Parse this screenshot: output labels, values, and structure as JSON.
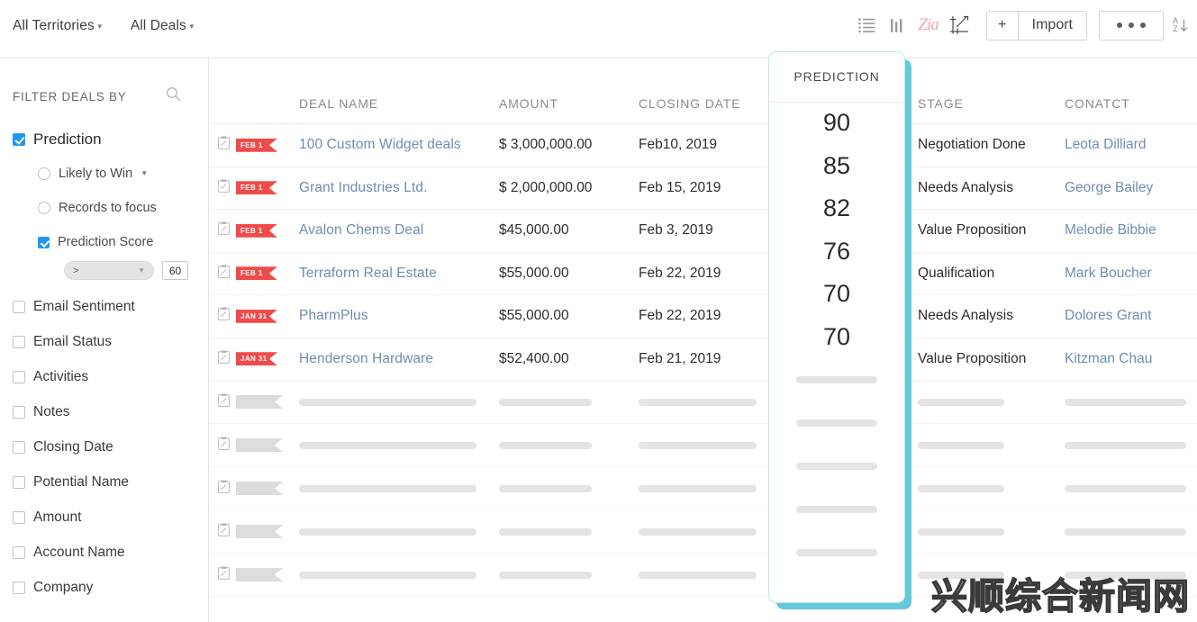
{
  "topbar": {
    "filters": [
      {
        "label": "All Territories",
        "icon": "chevron-down-icon"
      },
      {
        "label": "All Deals",
        "icon": "chevron-down-icon"
      }
    ],
    "icons": [
      {
        "name": "list-view-icon",
        "glyph": "☰"
      },
      {
        "name": "kanban-view-icon",
        "glyph": "|||"
      },
      {
        "name": "zia-logo-icon",
        "glyph": "Zia"
      },
      {
        "name": "chart-edit-icon",
        "glyph": "chart"
      }
    ],
    "add_label": "+",
    "import_label": "Import",
    "more_label": "...",
    "sort_icon": "sort-az-icon",
    "sort_top": "A",
    "sort_bottom": "Z"
  },
  "sidebar": {
    "title": "FILTER DEALS BY",
    "search_icon": "search-icon",
    "prediction": {
      "label": "Prediction",
      "checked": true,
      "options": [
        {
          "label": "Likely to Win",
          "type": "radio",
          "checked": false,
          "caret": true
        },
        {
          "label": "Records to focus",
          "type": "radio",
          "checked": false,
          "caret": false
        },
        {
          "label": "Prediction Score",
          "type": "checkbox",
          "checked": true,
          "caret": false
        }
      ],
      "score_operator": ">",
      "score_value": "60"
    },
    "items": [
      {
        "label": "Email Sentiment",
        "checked": false
      },
      {
        "label": "Email Status",
        "checked": false
      },
      {
        "label": "Activities",
        "checked": false
      },
      {
        "label": "Notes",
        "checked": false
      },
      {
        "label": "Closing Date",
        "checked": false
      },
      {
        "label": "Potential Name",
        "checked": false
      },
      {
        "label": "Amount",
        "checked": false
      },
      {
        "label": "Account Name",
        "checked": false
      },
      {
        "label": "Company",
        "checked": false
      }
    ]
  },
  "table": {
    "columns": [
      {
        "key": "icon",
        "label": ""
      },
      {
        "key": "name",
        "label": "DEAL NAME"
      },
      {
        "key": "amount",
        "label": "AMOUNT"
      },
      {
        "key": "date",
        "label": "CLOSING DATE"
      },
      {
        "key": "pred",
        "label": "PREDICTION"
      },
      {
        "key": "stage",
        "label": "STAGE"
      },
      {
        "key": "contact",
        "label": "CONATCT"
      }
    ],
    "rows": [
      {
        "badge": "FEB 1",
        "name": "100 Custom Widget deals",
        "amount": "$ 3,000,000.00",
        "date": "Feb10, 2019",
        "prediction": "90",
        "stage": "Negotiation Done",
        "contact": "Leota Dilliard"
      },
      {
        "badge": "FEB 1",
        "name": "Grant Industries Ltd.",
        "amount": "$ 2,000,000.00",
        "date": "Feb 15, 2019",
        "prediction": "85",
        "stage": "Needs Analysis",
        "contact": "George Bailey"
      },
      {
        "badge": "FEB 1",
        "name": "Avalon Chems Deal",
        "amount": "$45,000.00",
        "date": "Feb 3, 2019",
        "prediction": "82",
        "stage": "Value Proposition",
        "contact": "Melodie Bibbie"
      },
      {
        "badge": "FEB 1",
        "name": "Terraform Real Estate",
        "amount": "$55,000.00",
        "date": "Feb 22, 2019",
        "prediction": "76",
        "stage": "Qualification",
        "contact": "Mark Boucher"
      },
      {
        "badge": "JAN 31",
        "name": "PharmPlus",
        "amount": "$55,000.00",
        "date": "Feb 22, 2019",
        "prediction": "70",
        "stage": "Needs Analysis",
        "contact": "Dolores Grant"
      },
      {
        "badge": "JAN 31",
        "name": "Henderson Hardware",
        "amount": "$52,400.00",
        "date": "Feb 21, 2019",
        "prediction": "70",
        "stage": "Value Proposition",
        "contact": "Kitzman Chau"
      }
    ],
    "skeleton_row_count": 5
  },
  "colors": {
    "accent_cyan": "#66c9da",
    "highlight_border": "#bfe6ec",
    "link_blue": "#6f8db1",
    "badge_red": "#ef4b4b",
    "checkbox_blue": "#2196f3",
    "zia_pink": "#f0a9a9"
  },
  "watermark": {
    "text": "兴顺综合新闻网"
  }
}
